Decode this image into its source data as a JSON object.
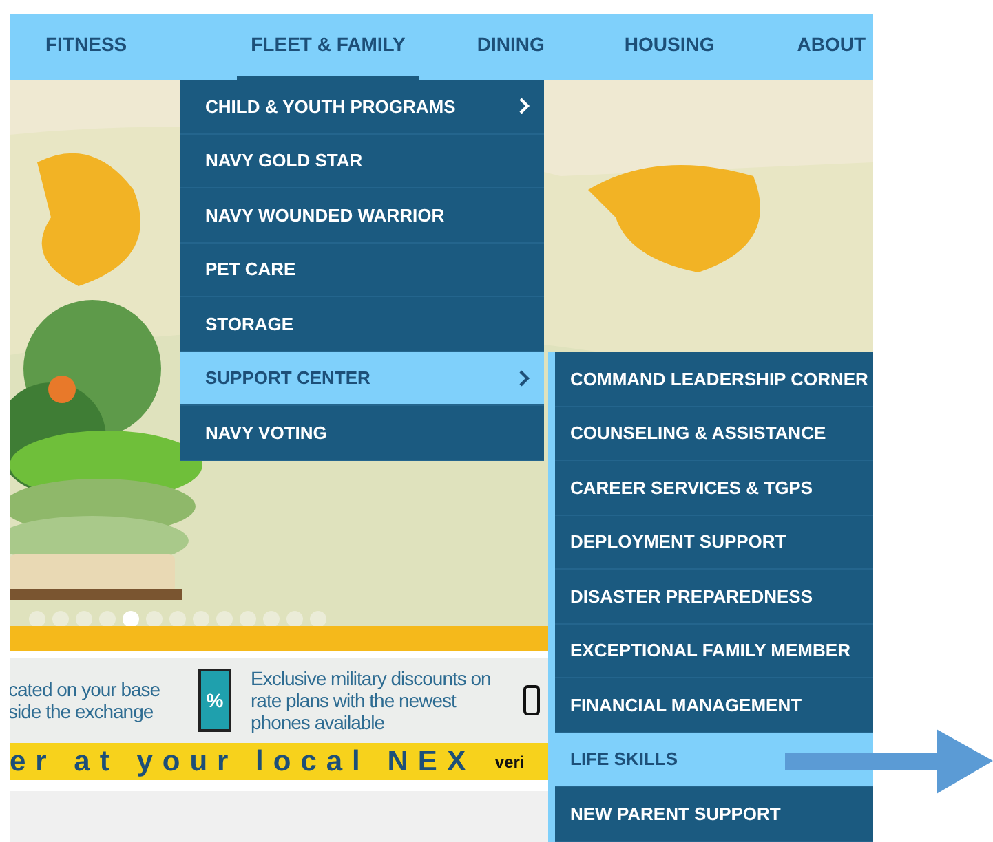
{
  "nav": [
    {
      "label": "FITNESS",
      "selected": false
    },
    {
      "label": "FLEET & FAMILY",
      "selected": true
    },
    {
      "label": "DINING",
      "selected": false
    },
    {
      "label": "HOUSING",
      "selected": false
    },
    {
      "label": "ABOUT",
      "selected": false
    }
  ],
  "menu": [
    {
      "label": "CHILD & YOUTH PROGRAMS",
      "submenu": true,
      "selected": false
    },
    {
      "label": "NAVY GOLD STAR",
      "submenu": false,
      "selected": false
    },
    {
      "label": "NAVY WOUNDED WARRIOR",
      "submenu": false,
      "selected": false
    },
    {
      "label": "PET CARE",
      "submenu": false,
      "selected": false
    },
    {
      "label": "STORAGE",
      "submenu": false,
      "selected": false
    },
    {
      "label": "SUPPORT CENTER",
      "submenu": true,
      "selected": true
    },
    {
      "label": "NAVY VOTING",
      "submenu": false,
      "selected": false
    }
  ],
  "submenu": [
    {
      "label": "COMMAND LEADERSHIP CORNER",
      "selected": false
    },
    {
      "label": "COUNSELING & ASSISTANCE",
      "selected": false
    },
    {
      "label": "CAREER SERVICES & TGPS",
      "selected": false
    },
    {
      "label": "DEPLOYMENT SUPPORT",
      "selected": false
    },
    {
      "label": "DISASTER PREPAREDNESS",
      "selected": false
    },
    {
      "label": "EXCEPTIONAL FAMILY MEMBER",
      "selected": false
    },
    {
      "label": "FINANCIAL MANAGEMENT",
      "selected": false
    },
    {
      "label": "LIFE SKILLS",
      "selected": true
    },
    {
      "label": "NEW PARENT SUPPORT",
      "selected": false
    }
  ],
  "carousel_dots": [
    {
      "selected": false
    },
    {
      "selected": false
    },
    {
      "selected": false
    },
    {
      "selected": false
    },
    {
      "selected": true
    },
    {
      "selected": false
    },
    {
      "selected": false
    },
    {
      "selected": false
    },
    {
      "selected": false
    },
    {
      "selected": false
    },
    {
      "selected": false
    },
    {
      "selected": false
    },
    {
      "selected": false
    }
  ],
  "ad": {
    "text_left": "cated on your base\nside the exchange",
    "badge": "%",
    "text_middle": "Exclusive military discounts on\nrate plans with the newest\nphones available",
    "tagline": "er at your local NEX",
    "brand": "veri"
  }
}
